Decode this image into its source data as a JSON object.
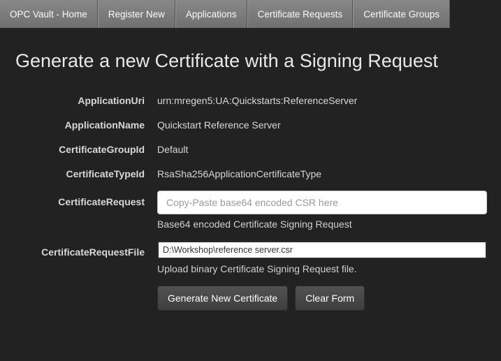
{
  "nav": {
    "items": [
      "OPC Vault - Home",
      "Register New",
      "Applications",
      "Certificate Requests",
      "Certificate Groups"
    ]
  },
  "page": {
    "title": "Generate a new Certificate with a Signing Request"
  },
  "form": {
    "applicationUri": {
      "label": "ApplicationUri",
      "value": "urn:mregen5:UA:Quickstarts:ReferenceServer"
    },
    "applicationName": {
      "label": "ApplicationName",
      "value": "Quickstart Reference Server"
    },
    "certificateGroupId": {
      "label": "CertificateGroupId",
      "value": "Default"
    },
    "certificateTypeId": {
      "label": "CertificateTypeId",
      "value": "RsaSha256ApplicationCertificateType"
    },
    "certificateRequest": {
      "label": "CertificateRequest",
      "placeholder": "Copy-Paste base64 encoded CSR here",
      "help": "Base64 encoded Certificate Signing Request"
    },
    "certificateRequestFile": {
      "label": "CertificateRequestFile",
      "value": "D:\\Workshop\\reference server.csr",
      "help": "Upload binary Certificate Signing Request file."
    }
  },
  "buttons": {
    "generate": "Generate New Certificate",
    "clear": "Clear Form"
  }
}
